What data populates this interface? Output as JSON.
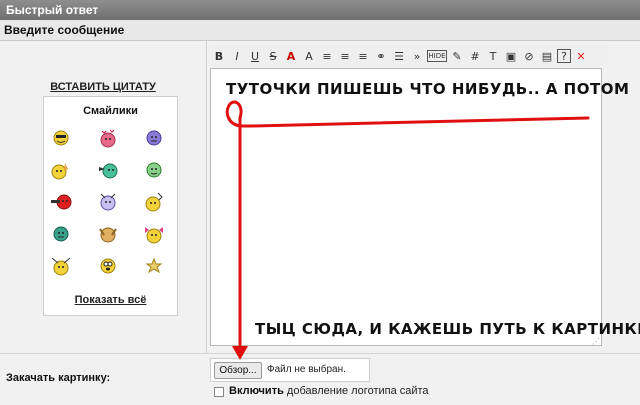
{
  "window": {
    "title": "Быстрый ответ"
  },
  "section": {
    "title": "Введите сообщение"
  },
  "sidebar": {
    "insert_quote": "ВСТАВИТЬ ЦИТАТУ",
    "smilies_title": "Смайлики",
    "show_all": "Показать всё"
  },
  "toolbar": {
    "buttons": [
      {
        "name": "bold-button",
        "glyph": "B"
      },
      {
        "name": "italic-button",
        "glyph": "I"
      },
      {
        "name": "underline-button",
        "glyph": "U"
      },
      {
        "name": "strike-button",
        "glyph": "S"
      },
      {
        "name": "font-color-button",
        "glyph": "A"
      },
      {
        "name": "font-size-button",
        "glyph": "A"
      },
      {
        "name": "align-left-button",
        "glyph": "≡"
      },
      {
        "name": "align-center-button",
        "glyph": "≡"
      },
      {
        "name": "align-right-button",
        "glyph": "≡"
      },
      {
        "name": "link-button",
        "glyph": "⚭"
      },
      {
        "name": "list-button",
        "glyph": "☰"
      },
      {
        "name": "quote-button",
        "glyph": "»"
      },
      {
        "name": "hide-button",
        "glyph": "HIDE"
      },
      {
        "name": "edit-button",
        "glyph": "✎"
      },
      {
        "name": "hash-button",
        "glyph": "#"
      },
      {
        "name": "text-button",
        "glyph": "T"
      },
      {
        "name": "image-button",
        "glyph": "▣"
      },
      {
        "name": "flash-button",
        "glyph": "⊘"
      },
      {
        "name": "video-button",
        "glyph": "▤"
      },
      {
        "name": "help-button",
        "glyph": "?"
      },
      {
        "name": "clear-button",
        "glyph": "✕"
      }
    ]
  },
  "editor": {
    "annotation_top": "ТУТОЧКИ ПИШЕШЬ ЧТО НИБУДЬ.. А ПОТОМ",
    "annotation_bottom": "ТЫЦ СЮДА, И КАЖЕШЬ ПУТЬ К КАРТИНКЕ"
  },
  "upload": {
    "label": "Закачать картинку:",
    "browse": "Обзор...",
    "status": "Файл не выбран.",
    "logo_bold": "Включить",
    "logo_rest": " добавление логотипа сайта"
  },
  "colors": {
    "accent_red": "#e01010",
    "titlebar": "#7a7a7a"
  }
}
